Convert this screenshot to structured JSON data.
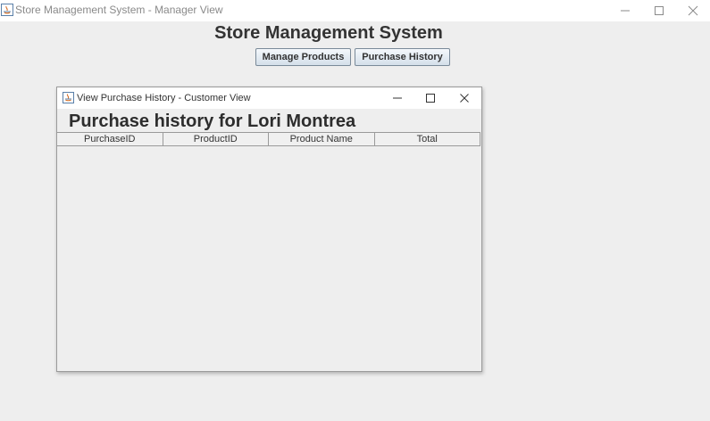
{
  "main_window": {
    "title": "Store Management System - Manager View",
    "heading": "Store Management System",
    "buttons": {
      "manage_products": "Manage Products",
      "purchase_history": "Purchase History"
    },
    "controls": {
      "minimize_icon": "minimize-icon",
      "maximize_icon": "maximize-icon",
      "close_icon": "close-icon"
    }
  },
  "purchase_window": {
    "title": "View Purchase History - Customer View",
    "heading": "Purchase history for Lori Montrea",
    "table": {
      "columns": [
        "PurchaseID",
        "ProductID",
        "Product Name",
        "Total"
      ],
      "rows": []
    }
  }
}
